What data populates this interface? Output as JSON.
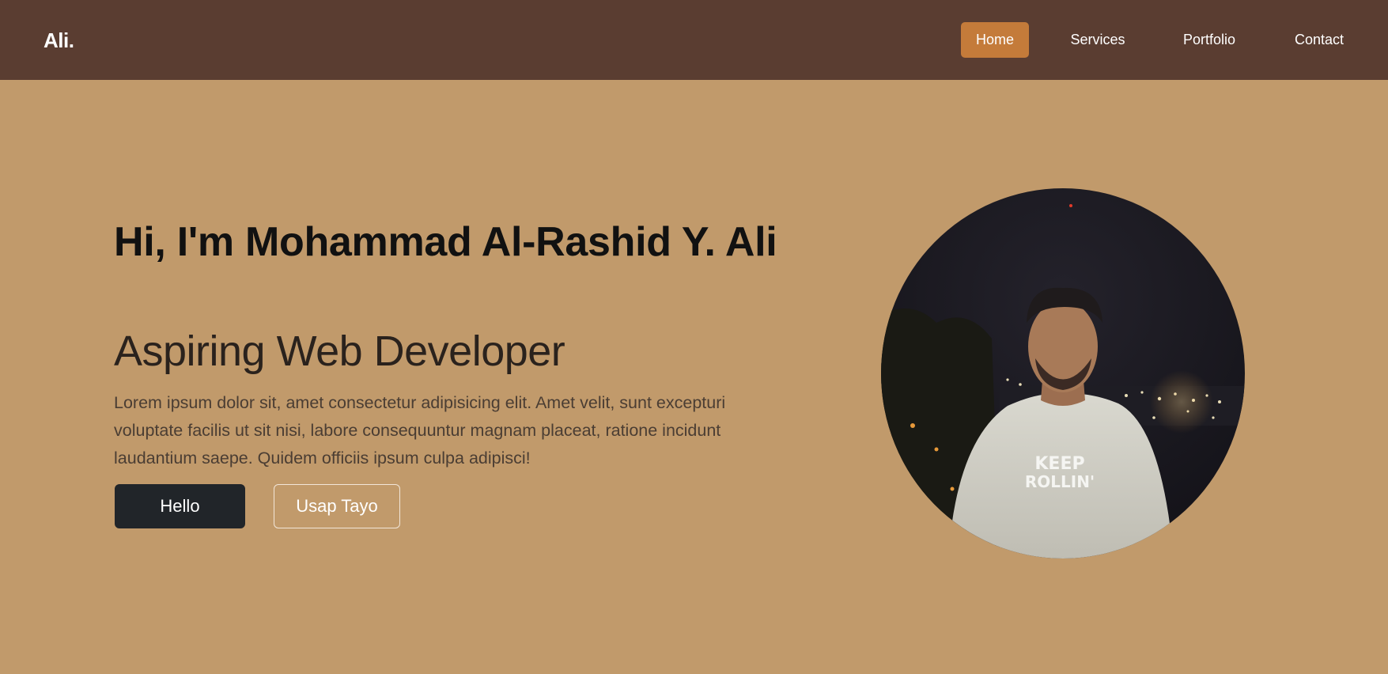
{
  "nav": {
    "brand": "Ali.",
    "items": [
      {
        "label": "Home",
        "active": true
      },
      {
        "label": "Services",
        "active": false
      },
      {
        "label": "Portfolio",
        "active": false
      },
      {
        "label": "Contact",
        "active": false
      }
    ]
  },
  "hero": {
    "title": "Hi, I'm Mohammad Al-Rashid Y. Ali",
    "subtitle": "Aspiring Web Developer",
    "description": "Lorem ipsum dolor sit, amet consectetur adipisicing elit. Amet velit, sunt excepturi voluptate facilis ut sit nisi, labore consequuntur magnam placeat, ratione incidunt laudantium saepe. Quidem officiis ipsum culpa adipisci!",
    "primary_button": "Hello",
    "secondary_button": "Usap Tayo",
    "photo": {
      "shirt_text_line1": "KEEP",
      "shirt_text_line2": "ROLLIN'"
    }
  },
  "colors": {
    "navbar_bg": "#5a3d31",
    "page_bg": "#c19a6b",
    "active_nav_bg": "#c47b3a",
    "primary_button_bg": "#212529"
  }
}
